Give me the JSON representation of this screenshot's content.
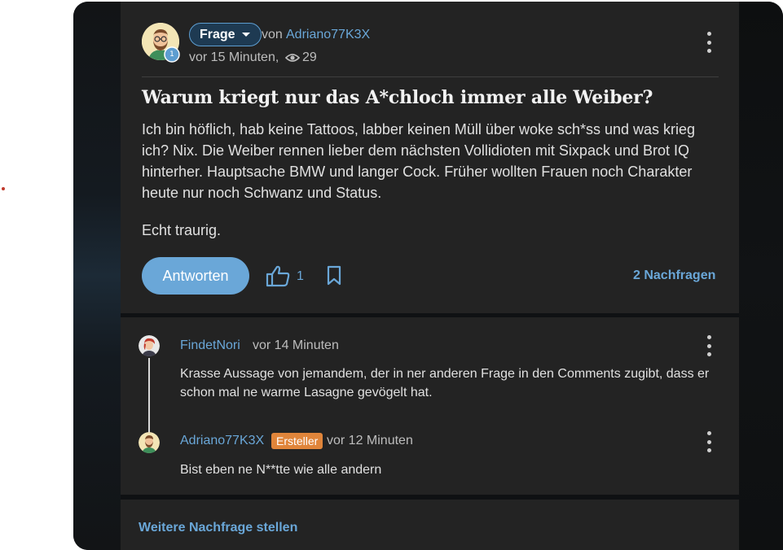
{
  "question": {
    "type_label": "Frage",
    "by_prefix": "von",
    "author": "Adriano77K3X",
    "author_level": "1",
    "time": "vor 15 Minuten,",
    "views": "29",
    "title": "Warum kriegt nur das A*chloch immer alle Weiber?",
    "body": "Ich bin höflich, hab keine Tattoos, labber keinen Müll über woke sch*ss und was krieg ich? Nix. Die Weiber rennen lieber dem nächsten Vollidioten mit Sixpack und Brot IQ hinterher. Hauptsache BMW und langer Cock. Früher wollten Frauen noch Charakter heute nur noch Schwanz und Status.",
    "body_closing": "Echt traurig.",
    "answer_button": "Antworten",
    "likes": "1",
    "follow_ups_link": "2 Nachfragen"
  },
  "comments": [
    {
      "user": "FindetNori",
      "time": "vor 14 Minuten",
      "text": "Krasse Aussage von jemandem, der in ner anderen Frage in den Comments zugibt, dass er schon mal ne warme Lasagne gevögelt hat."
    },
    {
      "user": "Adriano77K3X",
      "badge": "Ersteller",
      "time": "vor 12 Minuten",
      "text": "Bist eben ne N**tte wie alle andern"
    }
  ],
  "footer": {
    "ask_more": "Weitere Nachfrage stellen"
  },
  "colors": {
    "accent": "#6aa7d8",
    "card_bg": "#232323",
    "page_bg": "#0f1113",
    "badge_orange": "#e0853a"
  },
  "icons": [
    "avatar",
    "level-badge-icon",
    "chevron-down-icon",
    "eye-icon",
    "more-vert-icon",
    "thumbs-up-icon",
    "bookmark-icon"
  ]
}
